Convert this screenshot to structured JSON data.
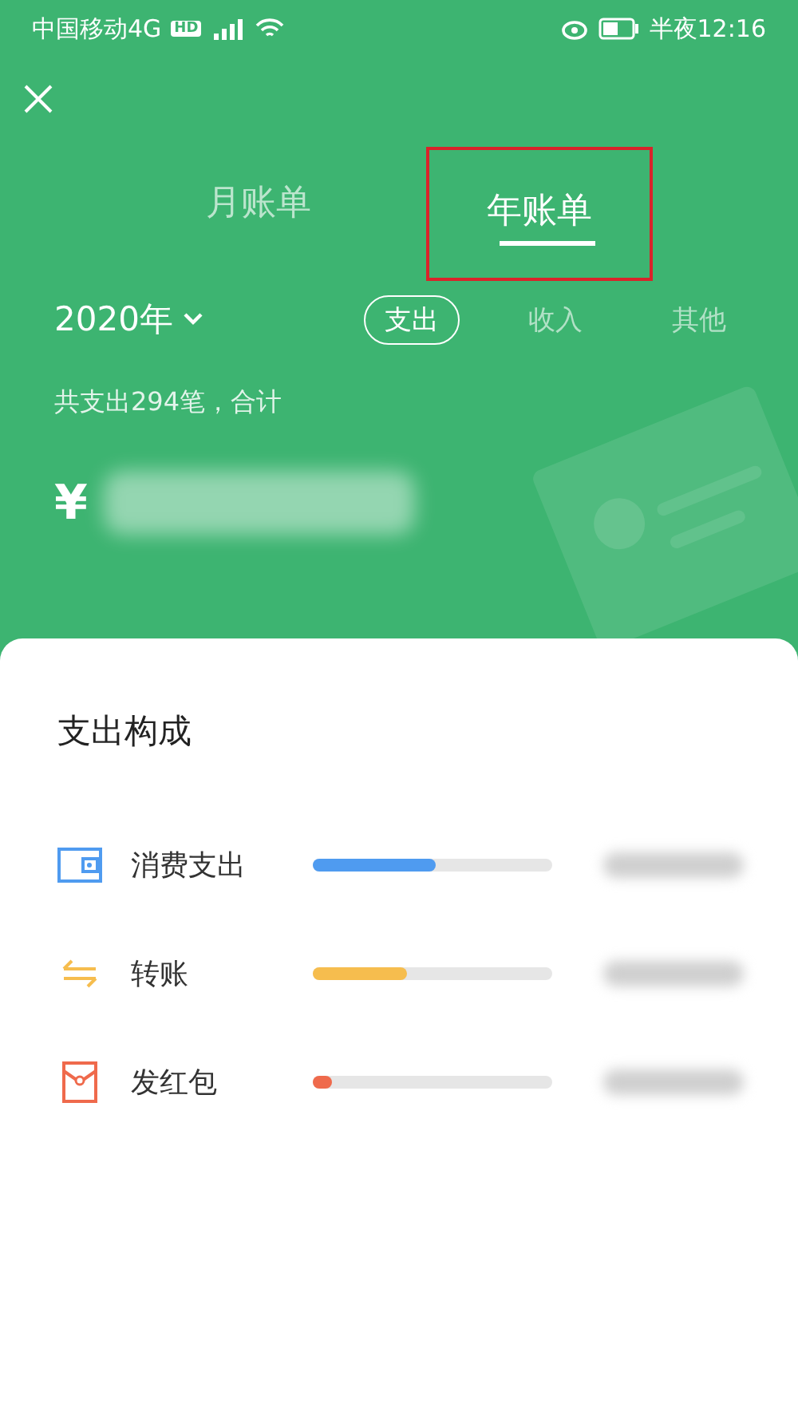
{
  "status_bar": {
    "carrier": "中国移动4G",
    "network_badge": "HD",
    "time": "半夜12:16"
  },
  "tabs": [
    {
      "label": "月账单",
      "selected": false,
      "highlighted": false
    },
    {
      "label": "年账单",
      "selected": true,
      "highlighted": true
    }
  ],
  "year_picker": {
    "label": "2020年"
  },
  "filters": [
    {
      "label": "支出",
      "selected": true
    },
    {
      "label": "收入",
      "selected": false
    },
    {
      "label": "其他",
      "selected": false
    }
  ],
  "summary": {
    "text": "共支出294笔，合计",
    "currency": "¥"
  },
  "breakdown": {
    "title": "支出构成",
    "items": [
      {
        "kind": "wallet",
        "label": "消费支出",
        "level": 0.51,
        "color": "#4f9bf0"
      },
      {
        "kind": "transfer",
        "label": "转账",
        "level": 0.39,
        "color": "#f6bd4e"
      },
      {
        "kind": "red_packet",
        "label": "发红包",
        "level": 0.08,
        "color": "#ef6a4c"
      }
    ]
  }
}
